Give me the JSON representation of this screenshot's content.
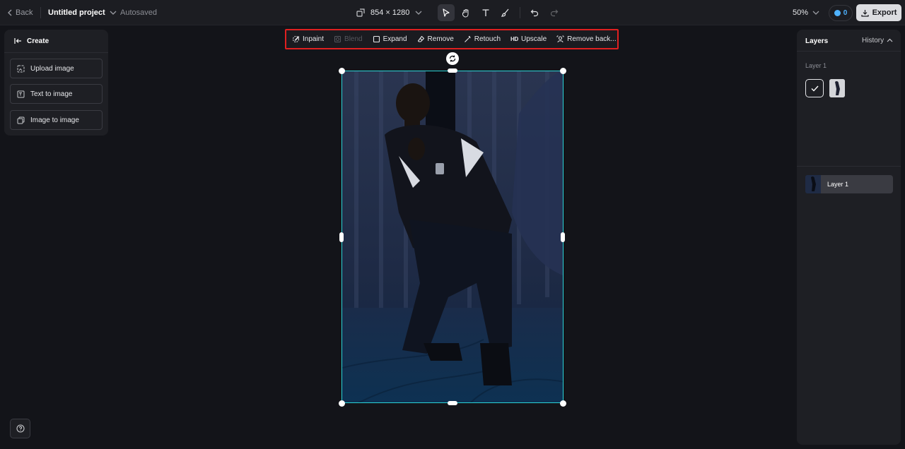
{
  "topbar": {
    "back_label": "Back",
    "project_name": "Untitled project",
    "save_status": "Autosaved",
    "canvas_size": "854 × 1280",
    "zoom": "50%",
    "credits": "0",
    "export_label": "Export"
  },
  "left_panel": {
    "title": "Create",
    "buttons": [
      "Upload image",
      "Text to image",
      "Image to image"
    ]
  },
  "canvas_toolbar": {
    "items": [
      {
        "label": "Inpaint",
        "icon": "inpaint-icon",
        "enabled": true
      },
      {
        "label": "Blend",
        "icon": "blend-icon",
        "enabled": false
      },
      {
        "label": "Expand",
        "icon": "expand-icon",
        "enabled": true
      },
      {
        "label": "Remove",
        "icon": "eraser-icon",
        "enabled": true
      },
      {
        "label": "Retouch",
        "icon": "wand-icon",
        "enabled": true
      },
      {
        "label": "Upscale",
        "icon": "hd-icon",
        "enabled": true
      },
      {
        "label": "Remove back...",
        "icon": "remove-background-icon",
        "enabled": true
      }
    ],
    "highlight_color": "#e02020"
  },
  "right_panel": {
    "title": "Layers",
    "history_label": "History",
    "group_label": "Layer 1",
    "layers": [
      {
        "name": "Layer 1"
      }
    ]
  },
  "colors": {
    "selection": "#2bd3d6",
    "accent": "#4fb3ff",
    "background": "#131419"
  }
}
